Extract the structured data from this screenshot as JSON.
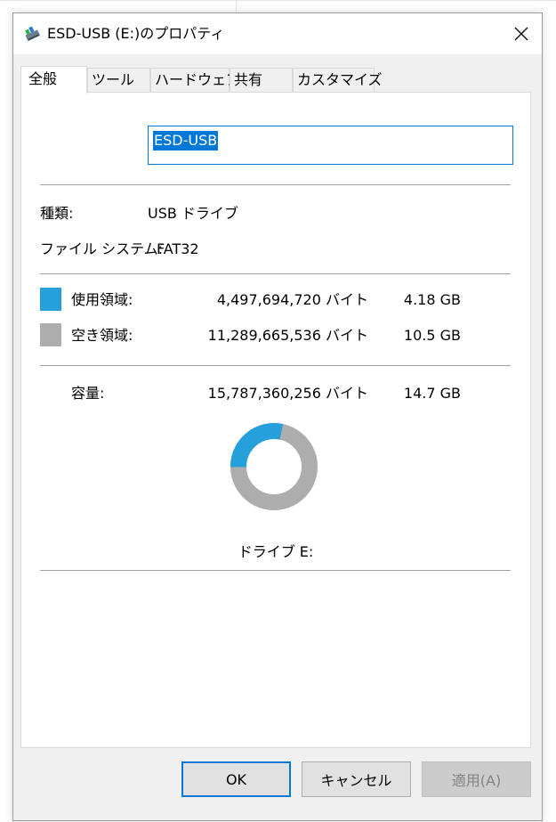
{
  "window": {
    "title": "ESD-USB (E:)のプロパティ",
    "close_icon": "close-icon",
    "drive_icon": "usb-drive-icon"
  },
  "tabs": [
    {
      "label": "全般",
      "active": true
    },
    {
      "label": "ツール",
      "active": false
    },
    {
      "label": "ハードウェア",
      "active": false
    },
    {
      "label": "共有",
      "active": false
    },
    {
      "label": "カスタマイズ",
      "active": false
    }
  ],
  "general": {
    "volume_name": "ESD-USB",
    "type_label": "種類:",
    "type_value": "USB ドライブ",
    "fs_label": "ファイル システム:",
    "fs_value": "FAT32",
    "used": {
      "label": "使用領域:",
      "bytes": "4,497,694,720 バイト",
      "size": "4.18 GB",
      "color": "#26a0da"
    },
    "free": {
      "label": "空き領域:",
      "bytes": "11,289,665,536 バイト",
      "size": "10.5 GB",
      "color": "#adadad"
    },
    "capacity": {
      "label": "容量:",
      "bytes": "15,787,360,256 バイト",
      "size": "14.7 GB"
    },
    "used_fraction": 0.285,
    "drive_label": "ドライブ E:"
  },
  "buttons": {
    "ok": "OK",
    "cancel": "キャンセル",
    "apply": "適用(A)"
  }
}
